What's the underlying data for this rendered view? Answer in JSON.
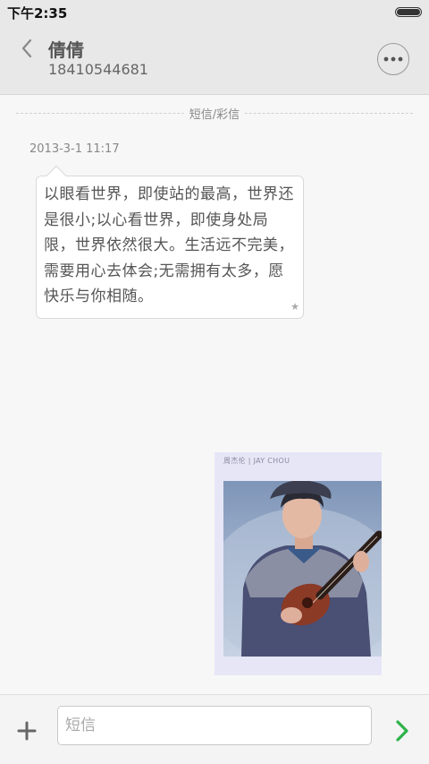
{
  "status_bar": {
    "time": "下午2:35",
    "battery_level": 1.0
  },
  "header": {
    "contact_name": "倩倩",
    "contact_number": "18410544681",
    "back_icon": "chevron-left-icon",
    "more_icon": "more-dots-icon"
  },
  "thread": {
    "type_label": "短信/彩信",
    "timestamp": "2013-3-1 11:17",
    "message_text": "以眼看世界，即使站的最高，世界还是很小;以心看世界，即使身处局限，世界依然很大。生活远不完美，需要用心去体会;无需拥有太多，愿快乐与你相随。",
    "star_icon": "star-icon",
    "mms_caption": "周杰伦 | JAY CHOU"
  },
  "composer": {
    "placeholder": "短信",
    "value": "",
    "add_icon": "plus-icon",
    "send_icon": "send-chevron-icon",
    "send_color": "#2db34a"
  }
}
